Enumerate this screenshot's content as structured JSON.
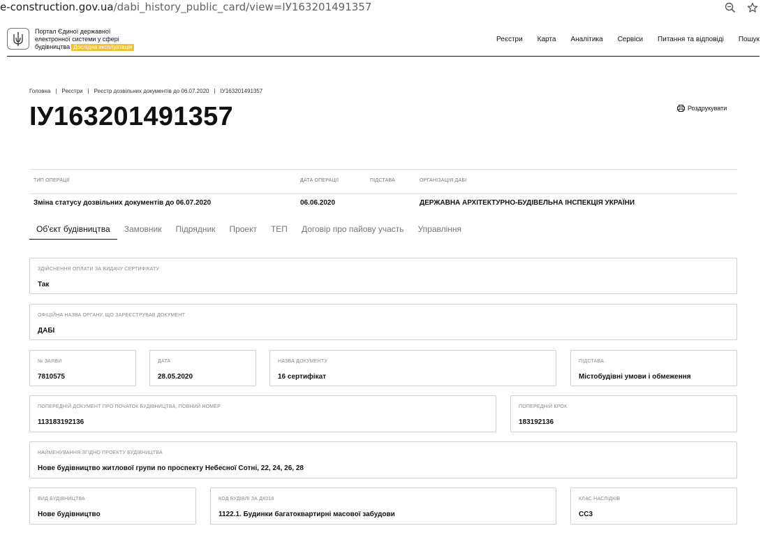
{
  "browser": {
    "url_domain": "e-construction.gov.ua",
    "url_path": "/dabi_history_public_card/view=ІУ163201491357"
  },
  "header": {
    "portal_line1": "Портал Єдиної державної",
    "portal_line2": "електронної системи у сфері",
    "portal_line3": "будівництва",
    "badge": "Дослідна експлуатація",
    "nav": [
      "Реєстри",
      "Карта",
      "Аналітика",
      "Сервіси",
      "Питання та відповіді",
      "Пошук"
    ]
  },
  "breadcrumb": [
    "Головна",
    "Реєстри",
    "Реєстр дозвільних документів до 06.07.2020",
    "ІУ163201491357"
  ],
  "title": "ІУ163201491357",
  "print_label": "Роздрукувати",
  "operation": {
    "headers": {
      "type": "ТИП ОПЕРАЦІЇ",
      "date": "ДАТА ОПЕРАЦІЇ",
      "basis": "ПІДСТАВА",
      "org": "ОРГАНІЗАЦІЯ ДАБІ"
    },
    "row": {
      "type": "Зміна статусу дозвільних документів до 06.07.2020",
      "date": "06.06.2020",
      "basis": "",
      "org": "ДЕРЖАВНА АРХІТЕКТУРНО-БУДІВЕЛЬНА ІНСПЕКЦІЯ УКРАЇНИ"
    }
  },
  "tabs": [
    "Об'єкт будівництва",
    "Замовник",
    "Підрядник",
    "Проект",
    "ТЕП",
    "Договір про пайову участь",
    "Управління"
  ],
  "fields": {
    "payment": {
      "label": "ЗДІЙСНЕННЯ ОПЛАТИ ЗА ВИДАЧУ СЕРТИФІКАТУ",
      "value": "Так"
    },
    "authority": {
      "label": "ОФІЦІЙНА НАЗВА ОРГАНУ, ЩО ЗАРЕЄСТРУВАВ ДОКУМЕНТ",
      "value": "ДАБІ"
    },
    "app_no": {
      "label": "№ ЗАЯВИ",
      "value": "7810575"
    },
    "date": {
      "label": "ДАТА",
      "value": "28.05.2020"
    },
    "doc_name": {
      "label": "НАЗВА ДОКУМЕНТУ",
      "value": "16 сертифікат"
    },
    "basis": {
      "label": "ПІДСТАВА",
      "value": "Містобудівні умови і обмеження"
    },
    "prev_doc": {
      "label": "ПОПЕРЕДНІЙ ДОКУМЕНТ ПРО ПОЧАТОК БУДІВНИЦТВА, ПОВНИЙ НОМЕР",
      "value": "113183192136"
    },
    "prev_step": {
      "label": "ПОПЕРЕДНІЙ КРОК",
      "value": "183192136"
    },
    "project_name": {
      "label": "НАЙМЕНУВАННЯ ЗГІДНО ПРОЕКТУ БУДІВНИЦТВА",
      "value": "Нове будівництво житлової групи по проспекту Небесної Сотні, 22, 24, 26, 28"
    },
    "constr_type": {
      "label": "ВИД БУДІВНИЦТВА",
      "value": "Нове будівництво"
    },
    "building_code": {
      "label": "КОД БУДІВЛІ ЗА ДК018",
      "value": "1122.1. Будинки багатоквартирні масової забудови"
    },
    "consequence": {
      "label": "КЛАС НАСЛІДКІВ",
      "value": "СС3"
    }
  }
}
